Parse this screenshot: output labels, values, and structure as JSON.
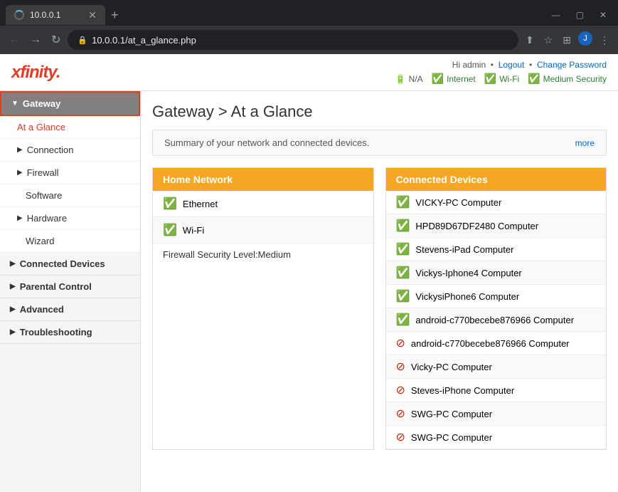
{
  "browser": {
    "tab_title": "10.0.0.1",
    "url": "10.0.0.1/at_a_glance.php",
    "new_tab_label": "+",
    "back_btn": "←",
    "forward_btn": "→",
    "reload_btn": "↻",
    "home_btn": "⌂"
  },
  "header": {
    "logo": "xfinity.",
    "greeting": "Hi admin",
    "logout_label": "Logout",
    "change_password_label": "Change Password",
    "status_items": [
      {
        "icon": "🔋",
        "label": "N/A",
        "type": "na"
      },
      {
        "icon": "✅",
        "label": "Internet",
        "type": "green"
      },
      {
        "icon": "✅",
        "label": "Wi-Fi",
        "type": "green"
      },
      {
        "icon": "✅",
        "label": "Medium Security",
        "type": "green"
      }
    ]
  },
  "sidebar": {
    "items": [
      {
        "label": "Gateway",
        "type": "section-active",
        "arrow": "▼"
      },
      {
        "label": "At a Glance",
        "type": "sub-active"
      },
      {
        "label": "Connection",
        "type": "sub",
        "arrow": "▶"
      },
      {
        "label": "Firewall",
        "type": "sub",
        "arrow": "▶"
      },
      {
        "label": "Software",
        "type": "sub2"
      },
      {
        "label": "Hardware",
        "type": "sub",
        "arrow": "▶"
      },
      {
        "label": "Wizard",
        "type": "sub2"
      },
      {
        "label": "Connected Devices",
        "type": "section",
        "arrow": "▶"
      },
      {
        "label": "Parental Control",
        "type": "section",
        "arrow": "▶"
      },
      {
        "label": "Advanced",
        "type": "section",
        "arrow": "▶"
      },
      {
        "label": "Troubleshooting",
        "type": "section",
        "arrow": "▶"
      }
    ]
  },
  "page": {
    "title": "Gateway > At a Glance",
    "summary_text": "Summary of your network and connected devices.",
    "more_link": "more"
  },
  "home_network": {
    "header": "Home Network",
    "items": [
      {
        "label": "Ethernet",
        "status": "ok"
      },
      {
        "label": "Wi-Fi",
        "status": "ok"
      }
    ],
    "firewall_label": "Firewall Security Level:",
    "firewall_value": "Medium"
  },
  "connected_devices": {
    "header": "Connected Devices",
    "devices": [
      {
        "label": "VICKY-PC Computer",
        "status": "ok"
      },
      {
        "label": "HPD89D67DF2480 Computer",
        "status": "ok"
      },
      {
        "label": "Stevens-iPad Computer",
        "status": "ok"
      },
      {
        "label": "Vickys-Iphone4 Computer",
        "status": "ok"
      },
      {
        "label": "VickysiPhone6 Computer",
        "status": "ok"
      },
      {
        "label": "android-c770becebe876966 Computer",
        "status": "ok"
      },
      {
        "label": "android-c770becebe876966 Computer",
        "status": "error"
      },
      {
        "label": "Vicky-PC Computer",
        "status": "error"
      },
      {
        "label": "Steves-iPhone Computer",
        "status": "error"
      },
      {
        "label": "SWG-PC Computer",
        "status": "error"
      },
      {
        "label": "SWG-PC Computer",
        "status": "error"
      }
    ]
  }
}
